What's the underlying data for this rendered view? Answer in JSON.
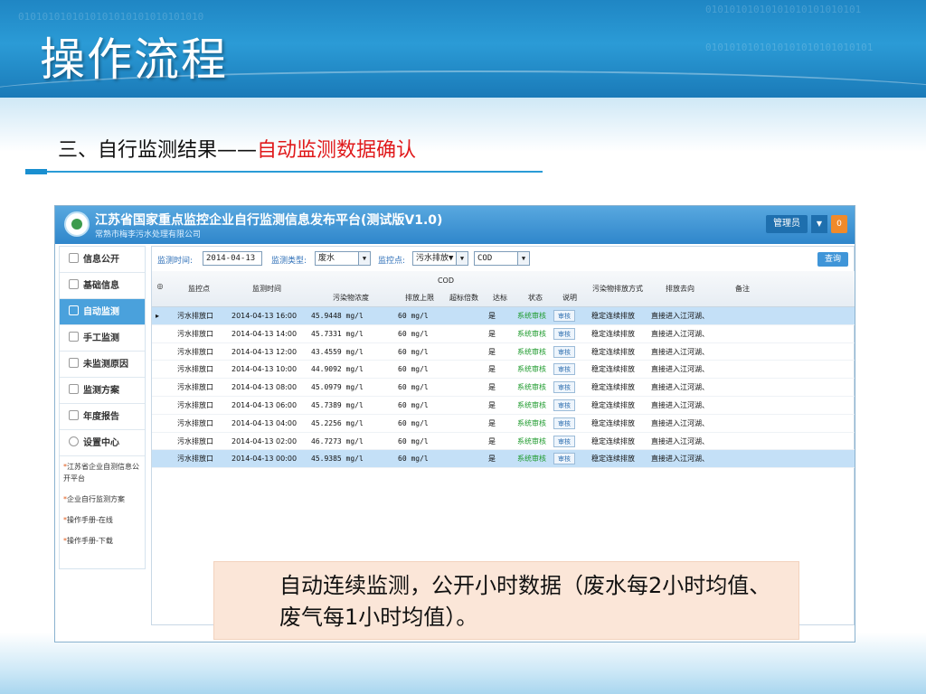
{
  "slide": {
    "title": "操作流程",
    "subtitle_prefix": "三、自行监测结果——",
    "subtitle_highlight": "自动监测数据确认",
    "note": "自动连续监测，公开小时数据（废水每2小时均值、废气每1小时均值）。"
  },
  "app": {
    "title": "江苏省国家重点监控企业自行监测信息发布平台(测试版V1.0)",
    "org": "常熟市梅李污水处理有限公司",
    "admin_label": "管理员",
    "admin_badge": "0"
  },
  "sidebar": {
    "items": [
      {
        "label": "信息公开"
      },
      {
        "label": "基础信息"
      },
      {
        "label": "自动监测"
      },
      {
        "label": "手工监测"
      },
      {
        "label": "未监测原因"
      },
      {
        "label": "监测方案"
      },
      {
        "label": "年度报告"
      },
      {
        "label": "设置中心"
      }
    ],
    "links": [
      {
        "label": "江苏省企业自测信息公开平台"
      },
      {
        "label": "企业自行监测方案"
      },
      {
        "label": "操作手册-在线"
      },
      {
        "label": "操作手册-下载"
      }
    ]
  },
  "filters": {
    "time_label": "监测时间:",
    "time_value": "2014-04-13",
    "type_label": "监测类型:",
    "type_value": "废水",
    "point_label": "监控点:",
    "point_value": "污水排放▼",
    "item_value": "COD",
    "query_label": "查询"
  },
  "grid": {
    "headers": {
      "point": "监控点",
      "time": "监测时间",
      "cod": "COD",
      "conc": "污染物浓度",
      "limit": "排放上限",
      "over": "超标倍数",
      "std": "达标",
      "status": "状态",
      "desc": "说明",
      "method": "污染物排放方式",
      "dest": "排放去向",
      "remark": "备注"
    },
    "rows": [
      {
        "point": "污水排放口",
        "time": "2014-04-13 16:00",
        "conc": "45.9448 mg/l",
        "limit": "60 mg/l",
        "std": "是",
        "status": "系统审核",
        "action": "审核",
        "method": "稳定连续排放",
        "dest": "直接进入江河湖、"
      },
      {
        "point": "污水排放口",
        "time": "2014-04-13 14:00",
        "conc": "45.7331 mg/l",
        "limit": "60 mg/l",
        "std": "是",
        "status": "系统审核",
        "action": "审核",
        "method": "稳定连续排放",
        "dest": "直接进入江河湖、"
      },
      {
        "point": "污水排放口",
        "time": "2014-04-13 12:00",
        "conc": "43.4559 mg/l",
        "limit": "60 mg/l",
        "std": "是",
        "status": "系统审核",
        "action": "审核",
        "method": "稳定连续排放",
        "dest": "直接进入江河湖、"
      },
      {
        "point": "污水排放口",
        "time": "2014-04-13 10:00",
        "conc": "44.9092 mg/l",
        "limit": "60 mg/l",
        "std": "是",
        "status": "系统审核",
        "action": "审核",
        "method": "稳定连续排放",
        "dest": "直接进入江河湖、"
      },
      {
        "point": "污水排放口",
        "time": "2014-04-13 08:00",
        "conc": "45.0979 mg/l",
        "limit": "60 mg/l",
        "std": "是",
        "status": "系统审核",
        "action": "审核",
        "method": "稳定连续排放",
        "dest": "直接进入江河湖、"
      },
      {
        "point": "污水排放口",
        "time": "2014-04-13 06:00",
        "conc": "45.7389 mg/l",
        "limit": "60 mg/l",
        "std": "是",
        "status": "系统审核",
        "action": "审核",
        "method": "稳定连续排放",
        "dest": "直接进入江河湖、"
      },
      {
        "point": "污水排放口",
        "time": "2014-04-13 04:00",
        "conc": "45.2256 mg/l",
        "limit": "60 mg/l",
        "std": "是",
        "status": "系统审核",
        "action": "审核",
        "method": "稳定连续排放",
        "dest": "直接进入江河湖、"
      },
      {
        "point": "污水排放口",
        "time": "2014-04-13 02:00",
        "conc": "46.7273 mg/l",
        "limit": "60 mg/l",
        "std": "是",
        "status": "系统审核",
        "action": "审核",
        "method": "稳定连续排放",
        "dest": "直接进入江河湖、"
      },
      {
        "point": "污水排放口",
        "time": "2014-04-13 00:00",
        "conc": "45.9385 mg/l",
        "limit": "60 mg/l",
        "std": "是",
        "status": "系统审核",
        "action": "审核",
        "method": "稳定连续排放",
        "dest": "直接进入江河湖、"
      }
    ]
  },
  "colors": {
    "header_blue": "#2b9bd6",
    "accent_red": "#e0191b",
    "selected_row": "#c4e0f7",
    "note_bg": "#fbe6d8",
    "status_green": "#1d9a2c"
  }
}
